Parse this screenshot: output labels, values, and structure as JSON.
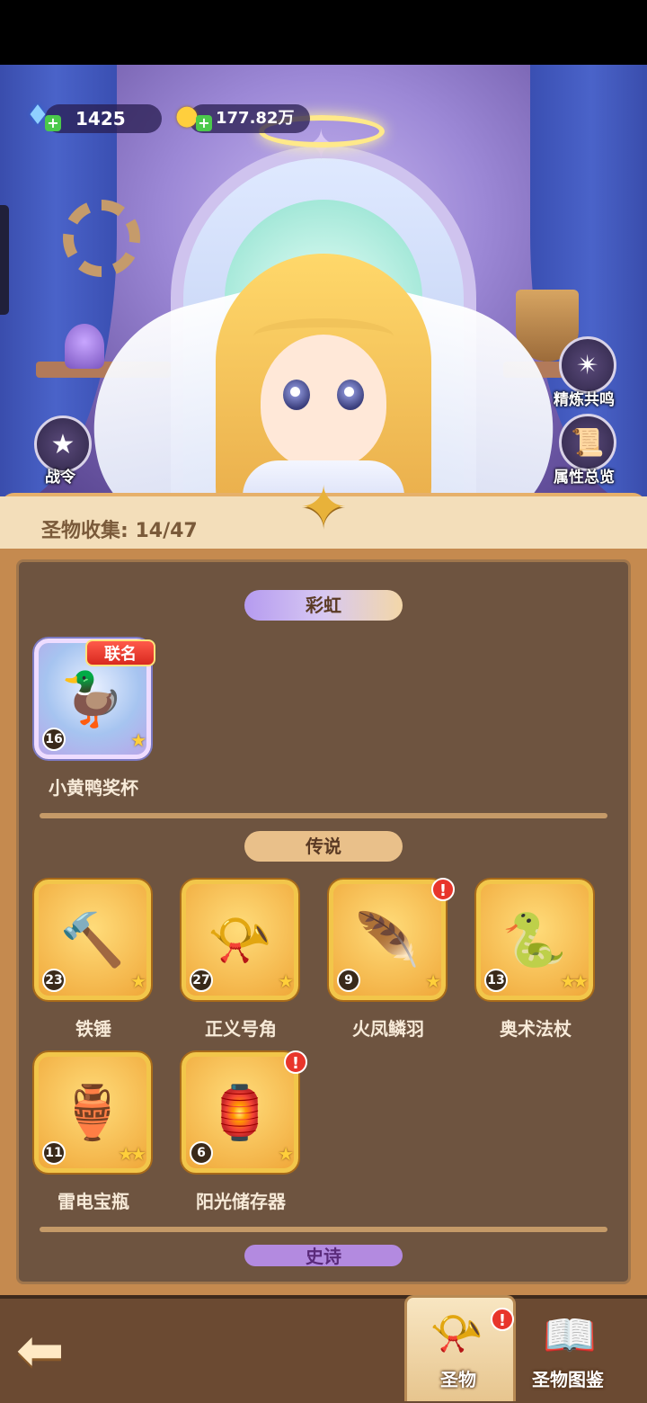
{
  "currency": {
    "gems": "1425",
    "gold": "177.82万"
  },
  "side_buttons": {
    "refine": "精炼共鸣",
    "attributes": "属性总览",
    "battle_pass": "战令"
  },
  "collection": {
    "label": "圣物收集: 14/47"
  },
  "sections": {
    "rainbow": "彩虹",
    "legend": "传说",
    "epic": "史诗"
  },
  "rainbow_items": [
    {
      "name": "小黄鸭奖杯",
      "level": "16",
      "stars": "★",
      "badge": "联名",
      "icon": "duck-trophy-icon"
    }
  ],
  "legend_items": [
    {
      "name": "铁锤",
      "level": "23",
      "stars": "★",
      "icon": "hammer-icon"
    },
    {
      "name": "正义号角",
      "level": "27",
      "stars": "★",
      "icon": "horn-icon"
    },
    {
      "name": "火凤鳞羽",
      "level": "9",
      "stars": "★",
      "alert": "!",
      "icon": "feather-icon"
    },
    {
      "name": "奥术法杖",
      "level": "13",
      "stars": "★★",
      "icon": "staff-icon"
    },
    {
      "name": "雷电宝瓶",
      "level": "11",
      "stars": "★★",
      "icon": "thunder-vase-icon"
    },
    {
      "name": "阳光储存器",
      "level": "6",
      "stars": "★",
      "alert": "!",
      "icon": "lantern-icon"
    }
  ],
  "bottom_tabs": {
    "relics": "圣物",
    "relic_codex": "圣物图鉴",
    "relics_alert": "!"
  },
  "colors": {
    "panel_bg": "#6e5440",
    "card_gold": "#f2c64a",
    "alert_red": "#e8352b"
  }
}
